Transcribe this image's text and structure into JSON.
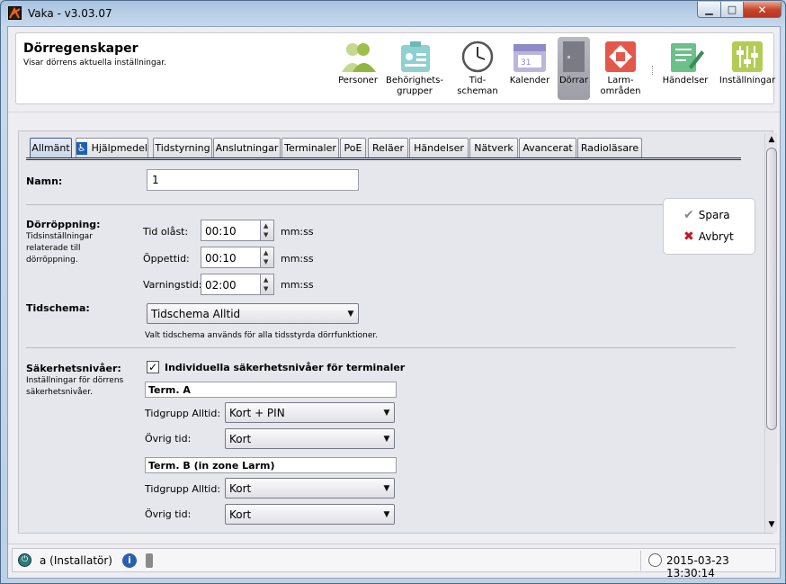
{
  "window": {
    "title": "Vaka - v3.03.07"
  },
  "header": {
    "title": "Dörregenskaper",
    "subtitle": "Visar dörrens aktuella inställningar."
  },
  "nav": [
    {
      "line1": "Personer",
      "line2": "",
      "icon": "persons-icon",
      "color": "#8fb640"
    },
    {
      "line1": "Behörighets-",
      "line2": "grupper",
      "icon": "badge-icon",
      "color": "#7ec3c3"
    },
    {
      "line1": "Tid-",
      "line2": "scheman",
      "icon": "clock-icon",
      "color": "#555555"
    },
    {
      "line1": "Kalender",
      "line2": "",
      "icon": "calendar-icon",
      "color": "#a6a2d3"
    },
    {
      "line1": "Dörrar",
      "line2": "",
      "icon": "door-icon",
      "color": "#8d8d96",
      "selected": true
    },
    {
      "line1": "Larm-",
      "line2": "områden",
      "icon": "alarm-zones-icon",
      "color": "#e4574b"
    },
    {
      "line1": "Händelser",
      "line2": "",
      "icon": "events-icon",
      "color": "#5bb57a"
    },
    {
      "line1": "Inställningar",
      "line2": "",
      "icon": "settings-sliders-icon",
      "color": "#a9c24a"
    }
  ],
  "tabs": [
    "Allmänt",
    "Hjälpmedel",
    "Tidstyrning",
    "Anslutningar",
    "Terminaler",
    "PoE",
    "Reläer",
    "Händelser",
    "Nätverk",
    "Avancerat",
    "Radioläsare"
  ],
  "form": {
    "name_label": "Namn:",
    "name_value": "1",
    "door_open_label": "Dörröppning:",
    "door_open_desc": [
      "Tidsinställningar",
      "relaterade till",
      "dörröppning."
    ],
    "unlock_label": "Tid olåst:",
    "unlock_value": "00:10",
    "open_label": "Öppettid:",
    "open_value": "00:10",
    "warn_label": "Varningstid:",
    "warn_value": "02:00",
    "unit": "mm:ss",
    "schedule_label": "Tidschema:",
    "schedule_value": "Tidschema Alltid",
    "schedule_hint": "Valt tidschema används för alla tidsstyrda dörrfunktioner.",
    "security_label": "Säkerhetsnivåer:",
    "security_desc": [
      "Inställningar för dörrens",
      "säkerhetsnivåer."
    ],
    "individual_check_label": "Individuella säkerhetsnivåer för terminaler",
    "individual_checked": true,
    "terminals": [
      {
        "name": "Term. A",
        "tg_label": "Tidgrupp Alltid:",
        "tg_value": "Kort + PIN",
        "other_label": "Övrig tid:",
        "other_value": "Kort"
      },
      {
        "name": "Term. B (in zone Larm)",
        "tg_label": "Tidgrupp Alltid:",
        "tg_value": "Kort",
        "other_label": "Övrig tid:",
        "other_value": "Kort"
      }
    ]
  },
  "actions": {
    "save": "Spara",
    "cancel": "Avbryt"
  },
  "status": {
    "user": "a (Installatör)",
    "datetime": "2015-03-23 13:30:14"
  }
}
